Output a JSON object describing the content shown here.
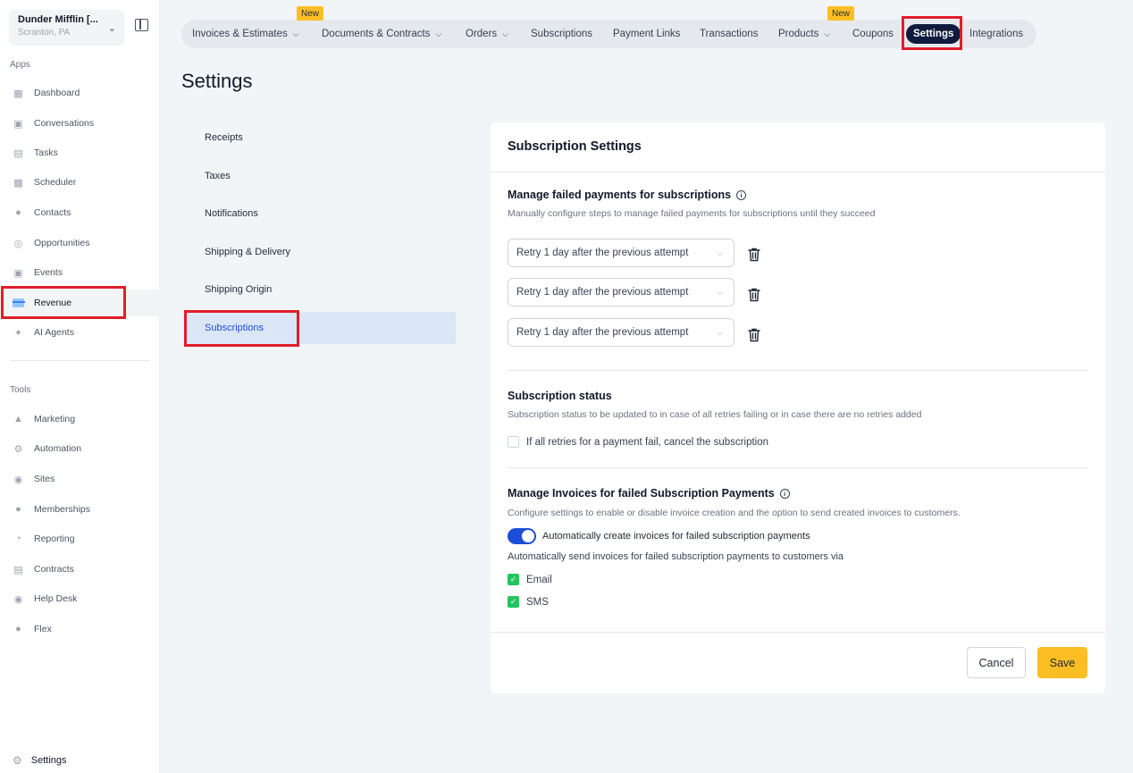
{
  "account": {
    "name": "Dunder Mifflin [...",
    "location": "Scranton, PA"
  },
  "sidebar": {
    "apps_label": "Apps",
    "apps": [
      {
        "label": "Dashboard",
        "icon": "dashboard-icon"
      },
      {
        "label": "Conversations",
        "icon": "chat-icon"
      },
      {
        "label": "Tasks",
        "icon": "task-icon"
      },
      {
        "label": "Scheduler",
        "icon": "calendar-icon"
      },
      {
        "label": "Contacts",
        "icon": "person-icon"
      },
      {
        "label": "Opportunities",
        "icon": "target-icon"
      },
      {
        "label": "Events",
        "icon": "event-icon"
      },
      {
        "label": "Revenue",
        "icon": "credit-card-icon",
        "active": true
      },
      {
        "label": "AI Agents",
        "icon": "sparkle-icon"
      }
    ],
    "tools_label": "Tools",
    "tools": [
      {
        "label": "Marketing",
        "icon": "megaphone-icon"
      },
      {
        "label": "Automation",
        "icon": "gears-icon"
      },
      {
        "label": "Sites",
        "icon": "globe-icon"
      },
      {
        "label": "Memberships",
        "icon": "group-icon"
      },
      {
        "label": "Reporting",
        "icon": "pie-chart-icon"
      },
      {
        "label": "Contracts",
        "icon": "document-icon"
      },
      {
        "label": "Help Desk",
        "icon": "help-icon"
      },
      {
        "label": "Flex",
        "icon": "people-icon"
      }
    ],
    "settings_label": "Settings"
  },
  "topnav": {
    "tabs": [
      {
        "label": "Invoices & Estimates",
        "dropdown": true,
        "badge": "New"
      },
      {
        "label": "Documents & Contracts",
        "dropdown": true
      },
      {
        "label": "Orders",
        "dropdown": true
      },
      {
        "label": "Subscriptions"
      },
      {
        "label": "Payment Links"
      },
      {
        "label": "Transactions"
      },
      {
        "label": "Products",
        "dropdown": true,
        "badge": "New"
      },
      {
        "label": "Coupons"
      },
      {
        "label": "Settings",
        "active": true
      },
      {
        "label": "Integrations"
      }
    ]
  },
  "page": {
    "title": "Settings"
  },
  "submenu": [
    "Receipts",
    "Taxes",
    "Notifications",
    "Shipping & Delivery",
    "Shipping Origin",
    "Subscriptions"
  ],
  "card": {
    "title": "Subscription Settings",
    "failed_payments": {
      "heading": "Manage failed payments for subscriptions",
      "description": "Manually configure steps to manage failed payments for subscriptions until they succeed",
      "retries": [
        "Retry 1 day after the previous attempt",
        "Retry 1 day after the previous attempt",
        "Retry 1 day after the previous attempt"
      ]
    },
    "status": {
      "heading": "Subscription status",
      "description": "Subscription status to be updated to in case of all retries failing or in case there are no retries added",
      "cancel_checkbox_label": "If all retries for a payment fail, cancel the subscription",
      "cancel_checked": false
    },
    "invoices": {
      "heading": "Manage Invoices for failed Subscription Payments",
      "description": "Configure settings to enable or disable invoice creation and the option to send created invoices to customers.",
      "toggle_label": "Automatically create invoices for failed subscription payments",
      "toggle_on": true,
      "send_via_label": "Automatically send invoices for failed subscription payments to customers via",
      "email_label": "Email",
      "email_checked": true,
      "sms_label": "SMS",
      "sms_checked": true
    },
    "cancel_label": "Cancel",
    "save_label": "Save"
  },
  "colors": {
    "accent": "#1d4ed8",
    "save": "#fbbf24",
    "highlight": "#e11d2a",
    "active_tab": "#0f1b3d"
  }
}
